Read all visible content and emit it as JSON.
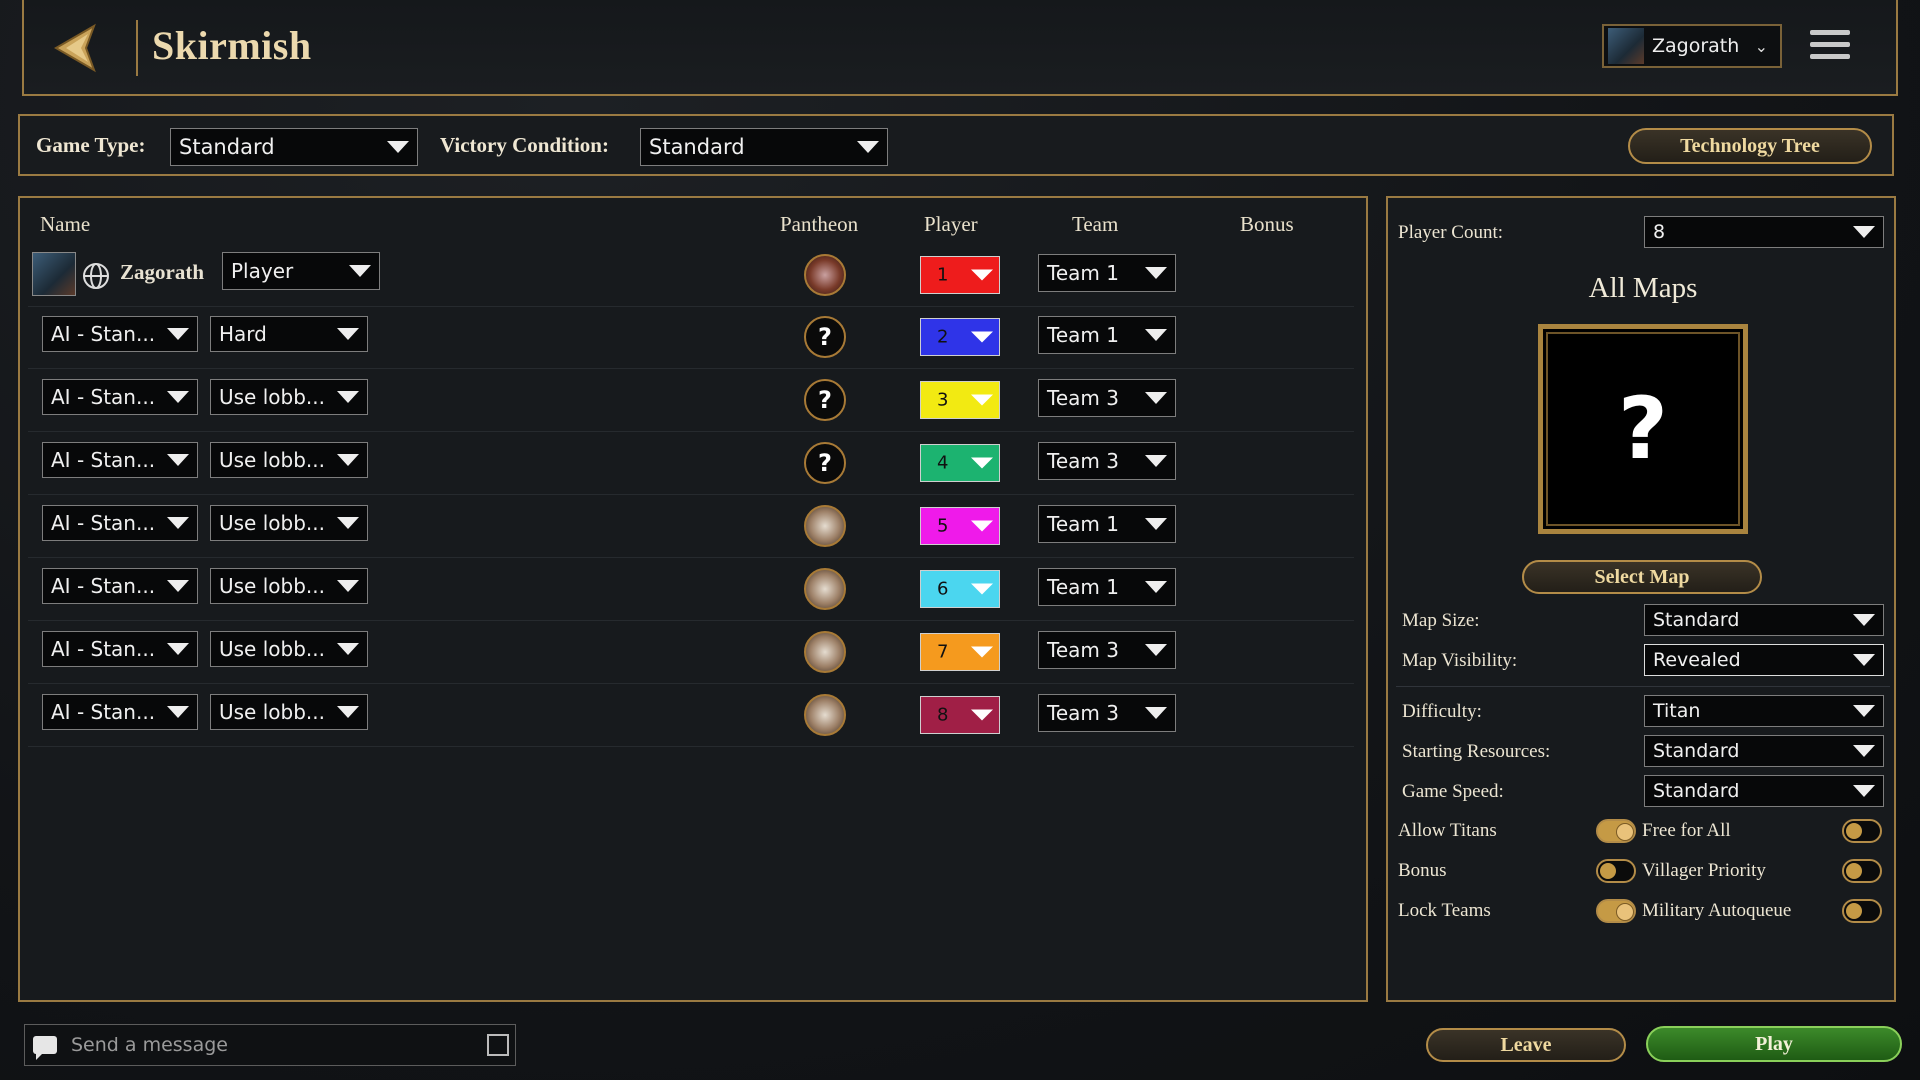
{
  "header": {
    "title": "Skirmish",
    "profile_name": "Zagorath"
  },
  "settings_bar": {
    "game_type_label": "Game Type:",
    "game_type_value": "Standard",
    "victory_label": "Victory Condition:",
    "victory_value": "Standard",
    "tech_tree": "Technology Tree"
  },
  "table": {
    "headers": {
      "name": "Name",
      "pantheon": "Pantheon",
      "player": "Player",
      "team": "Team",
      "bonus": "Bonus"
    },
    "host": {
      "name": "Zagorath",
      "type": "Player",
      "color_num": "1",
      "color": "#ee1c1c",
      "team": "Team 1",
      "pantheon_icon": "red-god-portrait"
    },
    "rows": [
      {
        "ai": "AI - Stan...",
        "diff": "Hard",
        "num": "2",
        "color": "#2f34e8",
        "team": "Team 1",
        "pantheon_icon": "random-question"
      },
      {
        "ai": "AI - Stan...",
        "diff": "Use lobb...",
        "num": "3",
        "color": "#f2ea12",
        "team": "Team 3",
        "pantheon_icon": "random-question"
      },
      {
        "ai": "AI - Stan...",
        "diff": "Use lobb...",
        "num": "4",
        "color": "#1cb370",
        "team": "Team 3",
        "pantheon_icon": "random-question"
      },
      {
        "ai": "AI - Stan...",
        "diff": "Use lobb...",
        "num": "5",
        "color": "#ef1aea",
        "team": "Team 1",
        "pantheon_icon": "bearded-god-portrait"
      },
      {
        "ai": "AI - Stan...",
        "diff": "Use lobb...",
        "num": "6",
        "color": "#4bd6ef",
        "team": "Team 1",
        "pantheon_icon": "bearded-god-portrait"
      },
      {
        "ai": "AI - Stan...",
        "diff": "Use lobb...",
        "num": "7",
        "color": "#f59a1e",
        "team": "Team 3",
        "pantheon_icon": "bearded-god-portrait"
      },
      {
        "ai": "AI - Stan...",
        "diff": "Use lobb...",
        "num": "8",
        "color": "#a01f46",
        "team": "Team 3",
        "pantheon_icon": "bearded-god-portrait"
      }
    ]
  },
  "right": {
    "player_count_label": "Player Count:",
    "player_count": "8",
    "maps_title": "All Maps",
    "map_placeholder": "?",
    "select_map": "Select Map",
    "map_size_label": "Map Size:",
    "map_size": "Standard",
    "map_vis_label": "Map Visibility:",
    "map_vis": "Revealed",
    "difficulty_label": "Difficulty:",
    "difficulty": "Titan",
    "resources_label": "Starting Resources:",
    "resources": "Standard",
    "speed_label": "Game Speed:",
    "speed": "Standard",
    "toggles": {
      "allow_titans": "Allow Titans",
      "free_for_all": "Free for All",
      "bonus": "Bonus",
      "villager_priority": "Villager Priority",
      "lock_teams": "Lock Teams",
      "military_autoqueue": "Military Autoqueue"
    }
  },
  "bottom": {
    "chat_placeholder": "Send a message",
    "leave": "Leave",
    "play": "Play"
  }
}
